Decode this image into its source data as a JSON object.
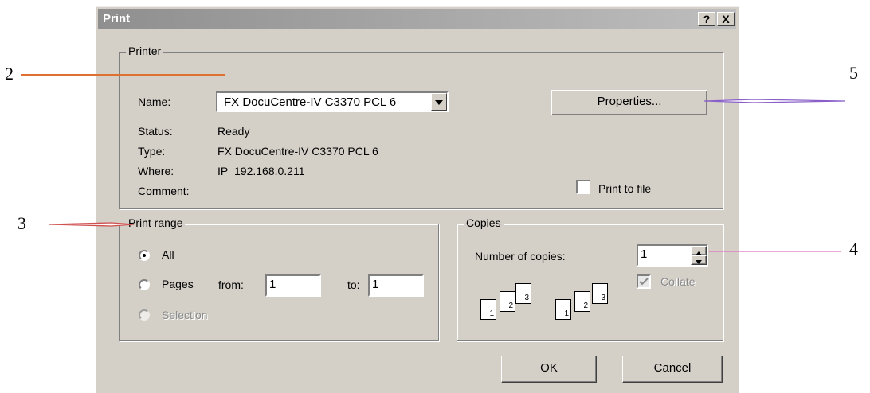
{
  "dialog": {
    "title": "Print",
    "help_button": "?",
    "close_button": "X"
  },
  "printer_group": {
    "legend": "Printer",
    "name_label": "Name:",
    "name_value": "FX DocuCentre-IV C3370 PCL 6",
    "properties_button": "Properties...",
    "status_label": "Status:",
    "status_value": "Ready",
    "type_label": "Type:",
    "type_value": "FX DocuCentre-IV C3370 PCL 6",
    "where_label": "Where:",
    "where_value": "IP_192.168.0.211",
    "comment_label": "Comment:",
    "comment_value": "",
    "print_to_file_label": "Print to file",
    "print_to_file_checked": false
  },
  "print_range": {
    "legend": "Print range",
    "all_label": "All",
    "pages_label": "Pages",
    "from_label": "from:",
    "from_value": "1",
    "to_label": "to:",
    "to_value": "1",
    "selection_label": "Selection",
    "selected": "all"
  },
  "copies": {
    "legend": "Copies",
    "number_label": "Number of copies:",
    "number_value": "1",
    "collate_label": "Collate",
    "collate_checked": true,
    "page_icons": [
      "1",
      "2",
      "3"
    ]
  },
  "buttons": {
    "ok": "OK",
    "cancel": "Cancel"
  },
  "annotations": {
    "a2": "2",
    "a3": "3",
    "a4": "4",
    "a5": "5",
    "line_colors": {
      "a2": "#e07030",
      "a3": "#d05050",
      "a4": "#e070c0",
      "a5": "#8a60c8"
    }
  }
}
